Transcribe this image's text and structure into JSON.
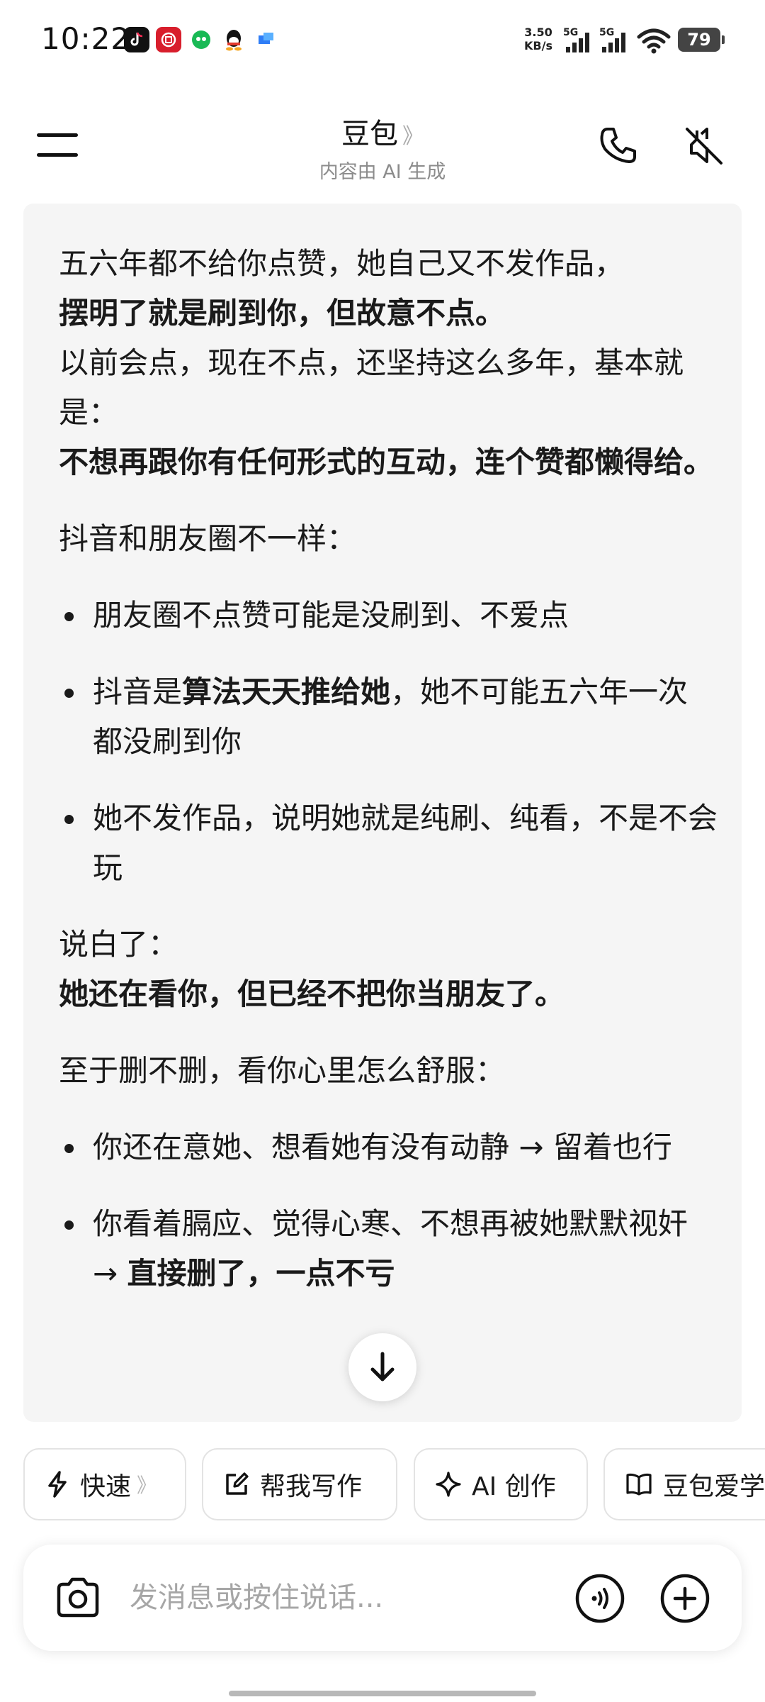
{
  "status_bar": {
    "time": "10:22",
    "net_speed_value": "3.50",
    "net_speed_unit": "KB/s",
    "signal1_tag": "5G",
    "signal2_tag": "5G",
    "battery": "79",
    "app_icons": [
      "douyin-icon",
      "app-red-icon",
      "app-green-icon",
      "qq-icon",
      "app-blue-icon"
    ]
  },
  "header": {
    "title": "豆包",
    "title_chevron": "》",
    "subtitle": "内容由 AI 生成"
  },
  "message": {
    "p1_line1": "五六年都不给你点赞，她自己又不发作品，",
    "p1_line2_bold": "摆明了就是刷到你，但故意不点。",
    "p1_line3": "以前会点，现在不点，还坚持这么多年，基本就是：",
    "p1_line4_bold": "不想再跟你有任何形式的互动，连个赞都懒得给。",
    "p2": "抖音和朋友圈不一样：",
    "bullets1": [
      {
        "text": "朋友圈不点赞可能是没刷到、不爱点"
      },
      {
        "pre": "抖音是",
        "bold": "算法天天推给她",
        "post": "，她不可能五六年一次都没刷到你"
      },
      {
        "text": "她不发作品，说明她就是纯刷、纯看，不是不会玩"
      }
    ],
    "p3_line1": "说白了：",
    "p3_line2_bold": "她还在看你，但已经不把你当朋友了。",
    "p4": "至于删不删，看你心里怎么舒服：",
    "bullets2": [
      {
        "text": "你还在意她、想看她有没有动静 → 留着也行"
      },
      {
        "pre": "你看着膈应、觉得心寒、不想再被她默默视奸 → ",
        "bold": "直接删了，一点不亏"
      }
    ]
  },
  "quick_actions": [
    {
      "label": "快速",
      "icon": "lightning-icon"
    },
    {
      "label": "帮我写作",
      "icon": "edit-icon"
    },
    {
      "label": "AI 创作",
      "icon": "sparkle-icon"
    },
    {
      "label": "豆包爱学",
      "icon": "book-icon"
    }
  ],
  "quick_chevron": "》",
  "input": {
    "placeholder": "发消息或按住说话..."
  }
}
